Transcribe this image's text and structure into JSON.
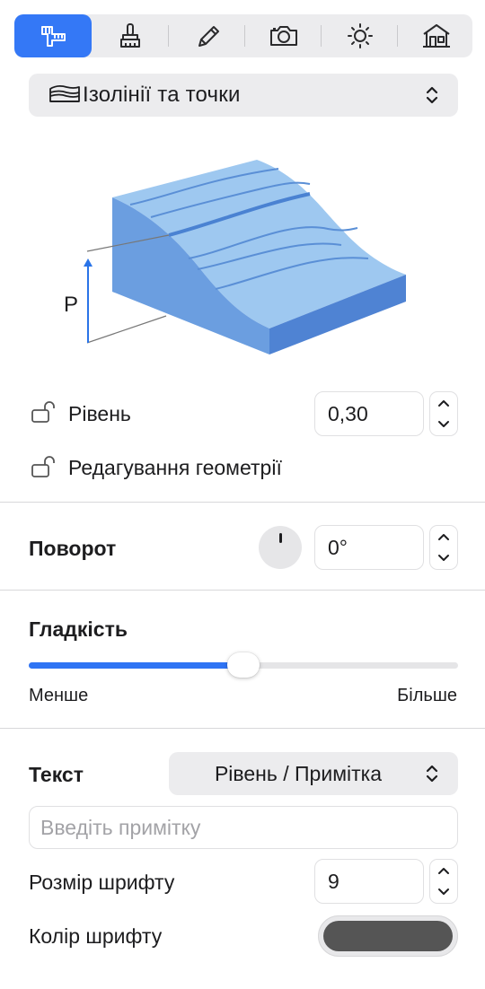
{
  "toolbar": {
    "tabs": [
      {
        "name": "measure-tool",
        "active": true
      },
      {
        "name": "brush-tool",
        "active": false
      },
      {
        "name": "pencil-tool",
        "active": false
      },
      {
        "name": "camera-tool",
        "active": false
      },
      {
        "name": "sun-tool",
        "active": false
      },
      {
        "name": "building-tool",
        "active": false
      }
    ]
  },
  "mode_popup": {
    "label": "Ізолінії та точки",
    "icon": "terrain-layers-icon"
  },
  "illustration": {
    "axis_label": "P"
  },
  "level": {
    "label": "Рівень",
    "value": "0,30",
    "lock_icon": "unlock-icon"
  },
  "geometry_edit": {
    "label": "Редагування геометрії",
    "lock_icon": "unlock-icon"
  },
  "rotation": {
    "title": "Поворот",
    "value": "0°"
  },
  "smoothness": {
    "title": "Гладкість",
    "min_label": "Менше",
    "max_label": "Більше",
    "value_fraction": 0.5
  },
  "text_section": {
    "title": "Текст",
    "mode_value": "Рівень / Примітка",
    "note_placeholder": "Введіть примітку",
    "note_value": "",
    "font_size_label": "Розмір шрифту",
    "font_size_value": "9",
    "font_color_label": "Колір шрифту",
    "font_color": "#555555"
  },
  "colors": {
    "accent": "#3478f6",
    "terrain_top": "#9ec8f0",
    "terrain_side": "#6b9ee0",
    "terrain_front": "#4f83d3",
    "contour": "#5a8fd6"
  }
}
